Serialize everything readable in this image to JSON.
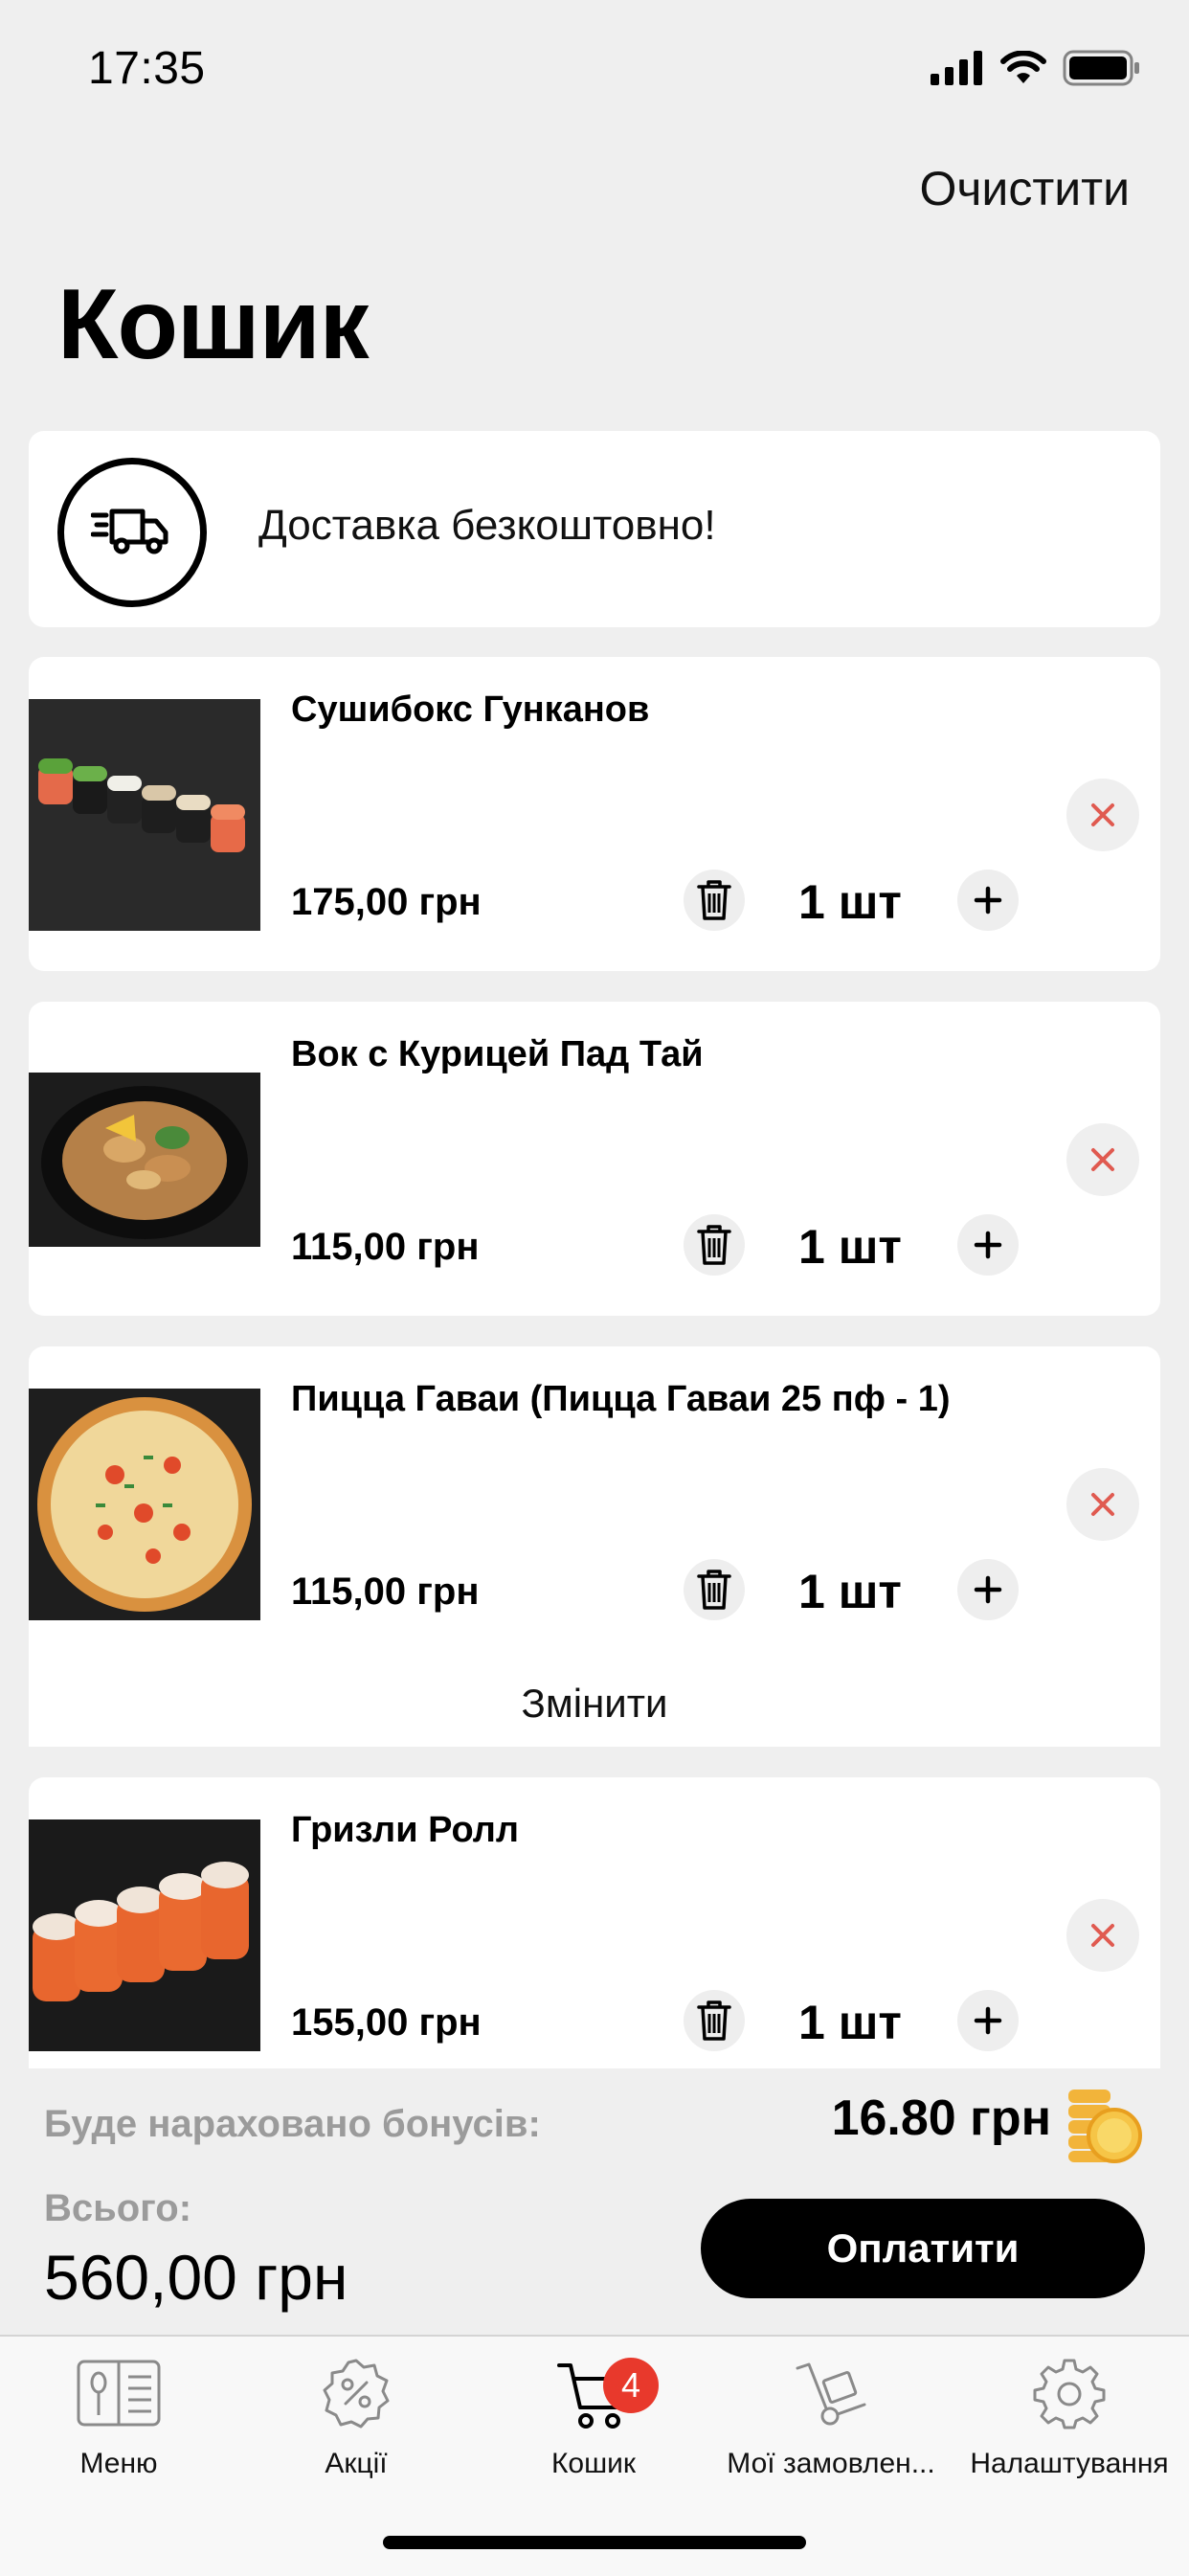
{
  "status_bar": {
    "time": "17:35"
  },
  "header": {
    "clear_label": "Очистити",
    "title": "Кошик"
  },
  "delivery": {
    "text": "Доставка безкоштовно!"
  },
  "items": [
    {
      "name": "Сушибокс Гунканов",
      "price": "175,00 грн",
      "qty": "1 шт"
    },
    {
      "name": "Вок с Курицей Пад Тай",
      "price": "115,00 грн",
      "qty": "1 шт"
    },
    {
      "name": "Пицца Гаваи (Пицца Гаваи 25 пф - 1)",
      "price": "115,00 грн",
      "qty": "1 шт"
    },
    {
      "name": "Гризли Ролл",
      "price": "155,00 грн",
      "qty": "1 шт"
    }
  ],
  "change_label": "Змінити",
  "summary": {
    "bonus_label": "Буде нараховано бонусів:",
    "bonus_value": "16.80 грн",
    "total_label": "Всього:",
    "total_value": "560,00 грн",
    "pay_label": "Оплатити"
  },
  "tabs": [
    {
      "label": "Меню",
      "icon": "menu-book-icon"
    },
    {
      "label": "Акції",
      "icon": "discount-icon"
    },
    {
      "label": "Кошик",
      "icon": "cart-icon",
      "badge": "4"
    },
    {
      "label": "Мої замовлен...",
      "icon": "orders-icon"
    },
    {
      "label": "Налаштування",
      "icon": "gear-icon"
    }
  ],
  "colors": {
    "accent": "#000000",
    "badge": "#e8392c",
    "remove": "#e05a50",
    "muted_text": "#9b9b9b"
  }
}
